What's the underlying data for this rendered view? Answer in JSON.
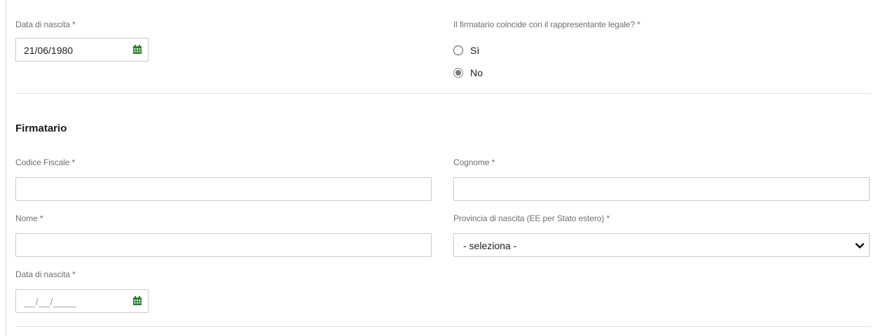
{
  "top": {
    "birth_date": {
      "label": "Data di nascita *",
      "value": "21/06/1980"
    },
    "signer_question": {
      "label": "Il firmatario coincide con il rappresentante legale? *",
      "options": [
        {
          "label": "Sì",
          "checked": false
        },
        {
          "label": "No",
          "checked": true
        }
      ]
    }
  },
  "signer": {
    "title": "Firmatario",
    "fiscal_code": {
      "label": "Codice Fiscale *",
      "value": ""
    },
    "surname": {
      "label": "Cognome *",
      "value": ""
    },
    "name": {
      "label": "Nome *",
      "value": ""
    },
    "birth_province": {
      "label": "Provincia di nascita (EE per Stato estero) *",
      "selected": "- seleziona -"
    },
    "birth_date": {
      "label": "Data di nascita *",
      "mask": "__/__/____"
    }
  },
  "icons": {
    "calendar": "calendar-icon",
    "chevron": "chevron-down-icon"
  },
  "colors": {
    "calendar_icon": "#2e7d32",
    "radio_checked": "#7a7a7a",
    "border": "#c9c9c9"
  }
}
